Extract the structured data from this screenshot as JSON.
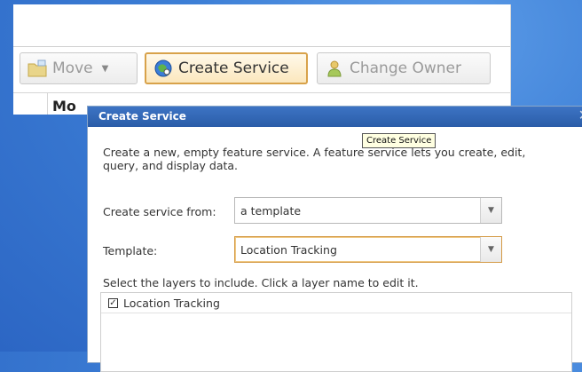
{
  "toolbar": {
    "move_label": "Move",
    "create_label": "Create Service",
    "owner_label": "Change Owner"
  },
  "table": {
    "column_header": "Mo"
  },
  "dialog": {
    "title": "Create Service",
    "description": "Create a new, empty feature service. A feature service lets you create, edit, query, and display data.",
    "create_from_label": "Create service from:",
    "create_from_value": "a template",
    "template_label": "Template:",
    "template_value": "Location Tracking",
    "select_layers_text": "Select the layers to include. Click a layer name to edit it.",
    "layers": [
      {
        "name": "Location Tracking",
        "checked": true
      }
    ]
  },
  "tooltip": {
    "text": "Create Service"
  },
  "icons": {
    "move": "folder-move-icon",
    "create": "globe-service-icon",
    "owner": "user-icon",
    "close": "close-icon"
  },
  "colors": {
    "title_bar": "#2f63b0",
    "active_border": "#d49a46"
  }
}
